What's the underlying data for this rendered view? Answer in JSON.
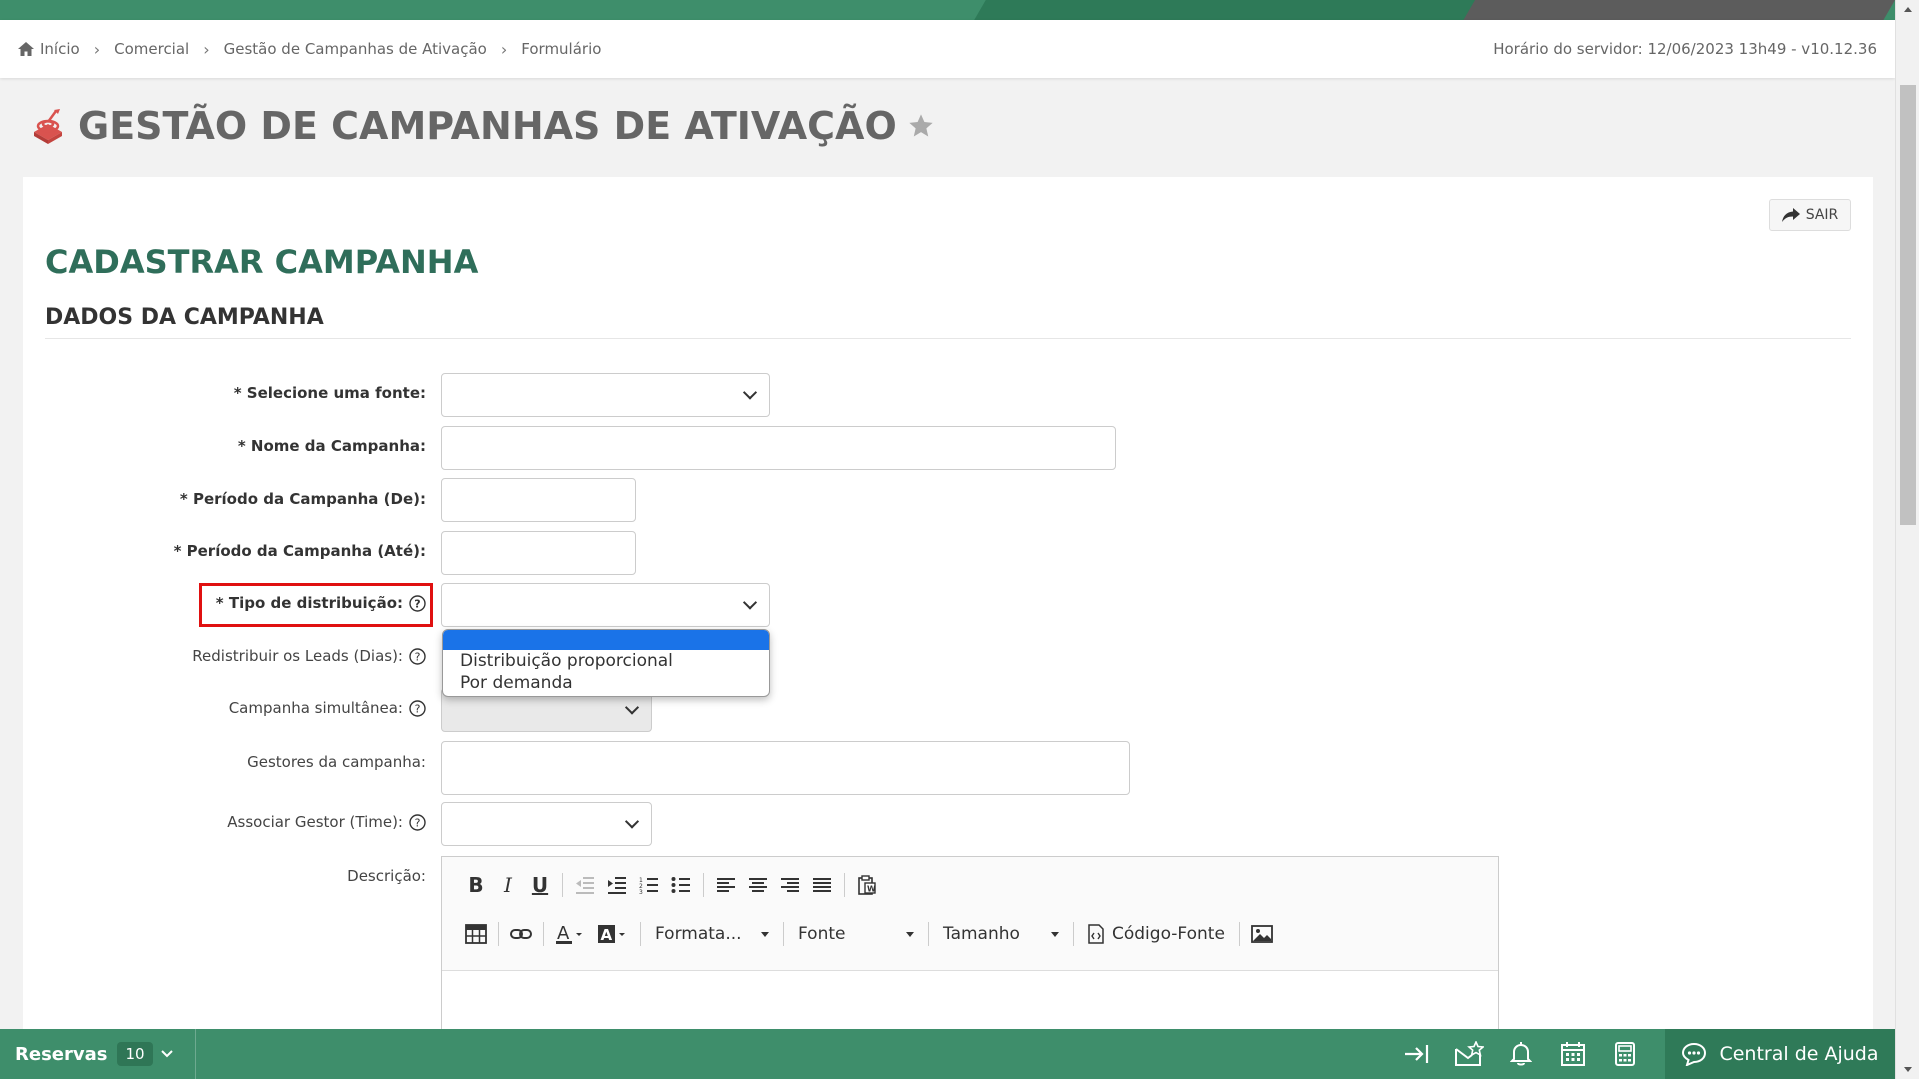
{
  "breadcrumb": {
    "items": [
      "Início",
      "Comercial",
      "Gestão de Campanhas de Ativação",
      "Formulário"
    ],
    "server_time": "Horário do servidor: 12/06/2023 13h49 - v10.12.36"
  },
  "page": {
    "title": "GESTÃO DE CAMPANHAS DE ATIVAÇÃO"
  },
  "form": {
    "exit_label": "SAIR",
    "heading": "CADASTRAR CAMPANHA",
    "section": "DADOS DA CAMPANHA",
    "labels": {
      "fonte": "* Selecione uma fonte:",
      "nome": "* Nome da Campanha:",
      "periodo_de": "* Período da Campanha (De):",
      "periodo_ate": "* Período da Campanha (Até):",
      "tipo_distribuicao": "* Tipo de distribuição:",
      "redistribuir": "Redistribuir os Leads (Dias):",
      "simultanea": "Campanha simultânea:",
      "gestores": "Gestores da campanha:",
      "associar_gestor": "Associar Gestor (Time):",
      "descricao": "Descrição:"
    },
    "distribution_options": [
      "",
      "Distribuição proporcional",
      "Por demanda"
    ]
  },
  "editor": {
    "format_label": "Formata...",
    "font_label": "Fonte",
    "size_label": "Tamanho",
    "source_label": "Código-Fonte"
  },
  "bottom_bar": {
    "reservas_label": "Reservas",
    "reservas_count": "10",
    "help_label": "Central de Ajuda"
  },
  "colors": {
    "brand_green": "#3e8e6b",
    "heading_green": "#2f6e5a",
    "highlight_red": "#e01010",
    "selected_blue": "#1a73e8"
  }
}
